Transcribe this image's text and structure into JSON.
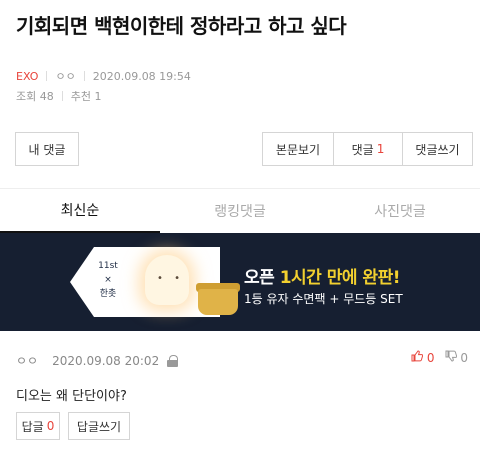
{
  "post": {
    "title": "기회되면 백현이한테 정하라고 하고 싶다",
    "category": "EXO",
    "author": "ㅇㅇ",
    "datetime": "2020.09.08 19:54",
    "views_label": "조회 48",
    "recommend_label": "추천 1"
  },
  "buttons": {
    "my_comments": "내 댓글",
    "body_view": "본문보기",
    "comments_label": "댓글",
    "comments_count": "1",
    "write_comment": "댓글쓰기"
  },
  "tabs": [
    {
      "label": "최신순",
      "active": true
    },
    {
      "label": "랭킹댓글",
      "active": false
    },
    {
      "label": "사진댓글",
      "active": false
    }
  ],
  "banner": {
    "logo_line1": "11st",
    "logo_line2": "×",
    "logo_line3": "한촛",
    "lamp_face": "• •",
    "headline_prefix": "오픈",
    "headline_highlight": "1시간 만에 완판!",
    "subline": "1등 유자 수면팩 + 무드등 SET",
    "bg_color": "#161f31",
    "highlight_color": "#f2d02f"
  },
  "comment": {
    "author": "ㅇㅇ",
    "datetime": "2020.09.08 20:02",
    "up_count": "0",
    "down_count": "0",
    "up_icon": "thumbs-up-icon",
    "down_icon": "thumbs-down-icon",
    "text": "디오는 왜 단단이야?",
    "reply_label": "답글",
    "reply_count": "0",
    "write_reply_label": "답글쓰기"
  },
  "colors": {
    "accent": "#e8453c"
  }
}
